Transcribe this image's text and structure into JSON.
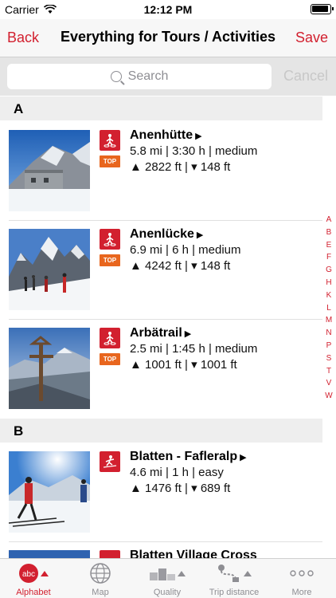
{
  "status": {
    "carrier": "Carrier",
    "time": "12:12 PM"
  },
  "nav": {
    "back": "Back",
    "title": "Everything for Tours / Activities",
    "save": "Save"
  },
  "search": {
    "placeholder": "Search",
    "cancel": "Cancel"
  },
  "sections": [
    {
      "letter": "A",
      "items": [
        {
          "title": "Anenhütte",
          "stats": "5.8 mi | 3:30 h | medium",
          "elevation": "▲ 2822 ft | ▾ 148 ft",
          "badge": "TOP",
          "activity_icon": "snowshoe-icon"
        },
        {
          "title": "Anenlücke",
          "stats": "6.9 mi | 6 h | medium",
          "elevation": "▲ 4242 ft | ▾ 148 ft",
          "badge": "TOP",
          "activity_icon": "snowshoe-icon"
        },
        {
          "title": "Arbätrail",
          "stats": "2.5 mi | 1:45 h | medium",
          "elevation": "▲ 1001 ft | ▾ 1001 ft",
          "badge": "TOP",
          "activity_icon": "snowshoe-icon"
        }
      ]
    },
    {
      "letter": "B",
      "items": [
        {
          "title": "Blatten - Fafleralp",
          "stats": "4.6 mi | 1 h | easy",
          "elevation": "▲ 1476 ft | ▾ 689 ft",
          "activity_icon": "cross-country-ski-icon"
        },
        {
          "title": "Blatten Village Cross"
        }
      ]
    }
  ],
  "index": [
    "A",
    "B",
    "E",
    "F",
    "G",
    "H",
    "K",
    "L",
    "M",
    "N",
    "P",
    "S",
    "T",
    "V",
    "W"
  ],
  "tabs": [
    {
      "label": "Alphabet",
      "icon": "abc-icon",
      "active": true
    },
    {
      "label": "Map",
      "icon": "globe-icon"
    },
    {
      "label": "Quality",
      "icon": "podium-icon"
    },
    {
      "label": "Trip distance",
      "icon": "route-icon"
    },
    {
      "label": "More",
      "icon": "more-dots-icon"
    }
  ],
  "colors": {
    "accent": "#d2202f",
    "badge": "#e8661e"
  }
}
